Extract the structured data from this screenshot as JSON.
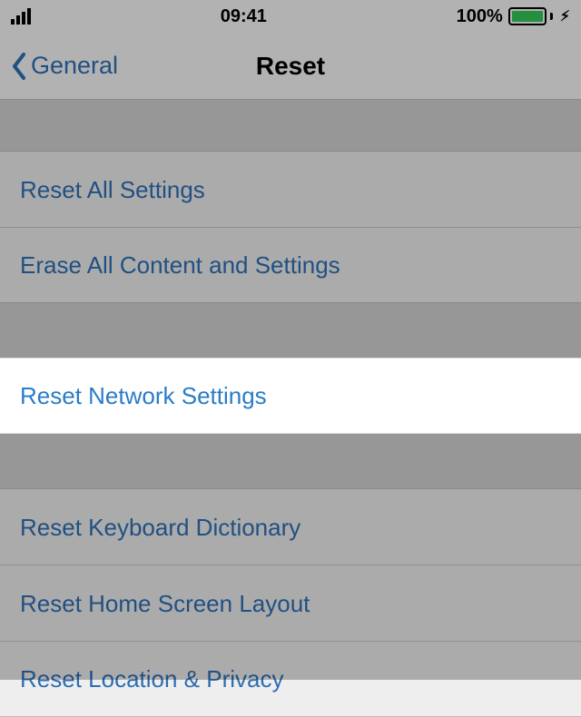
{
  "status": {
    "time": "09:41",
    "battery_pct": "100%"
  },
  "nav": {
    "back_label": "General",
    "title": "Reset"
  },
  "rows": {
    "reset_all": "Reset All Settings",
    "erase_all": "Erase All Content and Settings",
    "reset_network": "Reset Network Settings",
    "reset_keyboard": "Reset Keyboard Dictionary",
    "reset_home": "Reset Home Screen Layout",
    "reset_location": "Reset Location & Privacy"
  }
}
